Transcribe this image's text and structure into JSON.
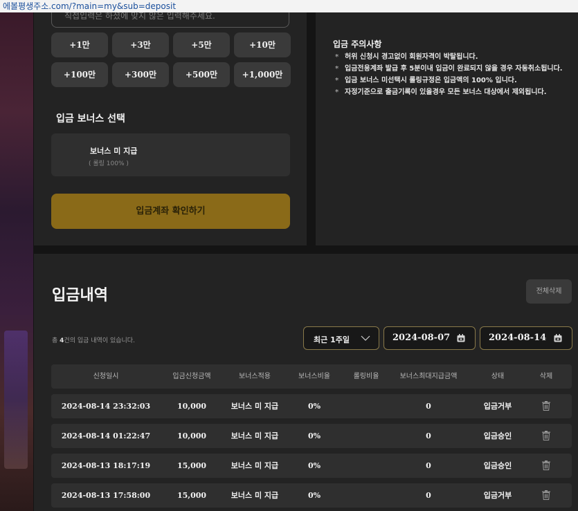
{
  "browser": {
    "url": "에볼평생주소.com/?main=my&sub=deposit"
  },
  "deposit": {
    "amount_placeholder": "직접입력은 하셨에 맞지 않은 입력해주세요.",
    "amount_buttons": [
      "+1만",
      "+3만",
      "+5만",
      "+10만",
      "+100만",
      "+300만",
      "+500만",
      "+1,000만"
    ],
    "bonus_section_title": "입금 보너스 선택",
    "bonus_option": {
      "name": "보너스 미 지급",
      "sub": "( 롤링 100% )"
    },
    "confirm_label": "입금계좌 확인하기"
  },
  "notice": {
    "title": "입금 주의사항",
    "bullet": "*",
    "items": [
      "허위 신청시 경고없이 회원자격이 박탈됩니다.",
      "입금전용계좌 발급 후 5분이내 입금이 완료되지 않을 경우 자동취소됩니다.",
      "입금 보너스 미선택시 롤링규정은 입금액의 100% 입니다.",
      "자정기준으로 출금기록이 있을경우 모든 보너스 대상에서 제외됩니다."
    ]
  },
  "history": {
    "title": "입금내역",
    "delete_all_label": "전체삭제",
    "count_prefix": "총 ",
    "count": "4",
    "count_suffix": "건의 입금 내역이 있습니다.",
    "period_label": "최근 1주일",
    "date_from": "2024-08-07",
    "date_to": "2024-08-14",
    "columns": [
      "신청일시",
      "입금신청금액",
      "보너스적용",
      "보너스비율",
      "롤링비율",
      "보너스최대지급금액",
      "상태",
      "삭제"
    ],
    "rows": [
      {
        "datetime": "2024-08-14 23:32:03",
        "amount": "10,000",
        "bonus": "보너스 미 지급",
        "bonus_rate": "0%",
        "rolling_rate": "",
        "bonus_max": "0",
        "status": "입금거부"
      },
      {
        "datetime": "2024-08-14 01:22:47",
        "amount": "10,000",
        "bonus": "보너스 미 지급",
        "bonus_rate": "0%",
        "rolling_rate": "",
        "bonus_max": "0",
        "status": "입금승인"
      },
      {
        "datetime": "2024-08-13 18:17:19",
        "amount": "15,000",
        "bonus": "보너스 미 지급",
        "bonus_rate": "0%",
        "rolling_rate": "",
        "bonus_max": "0",
        "status": "입금승인"
      },
      {
        "datetime": "2024-08-13 17:58:00",
        "amount": "15,000",
        "bonus": "보너스 미 지급",
        "bonus_rate": "0%",
        "rolling_rate": "",
        "bonus_max": "0",
        "status": "입금거부"
      }
    ]
  },
  "colors": {
    "accent": "#8a6a18",
    "panel": "#232323",
    "row": "#2f2f2f",
    "button": "#3a3a3a"
  },
  "icons": {
    "calendar": "calendar-icon",
    "trash": "trash-icon",
    "chevron": "chevron-down-icon"
  }
}
